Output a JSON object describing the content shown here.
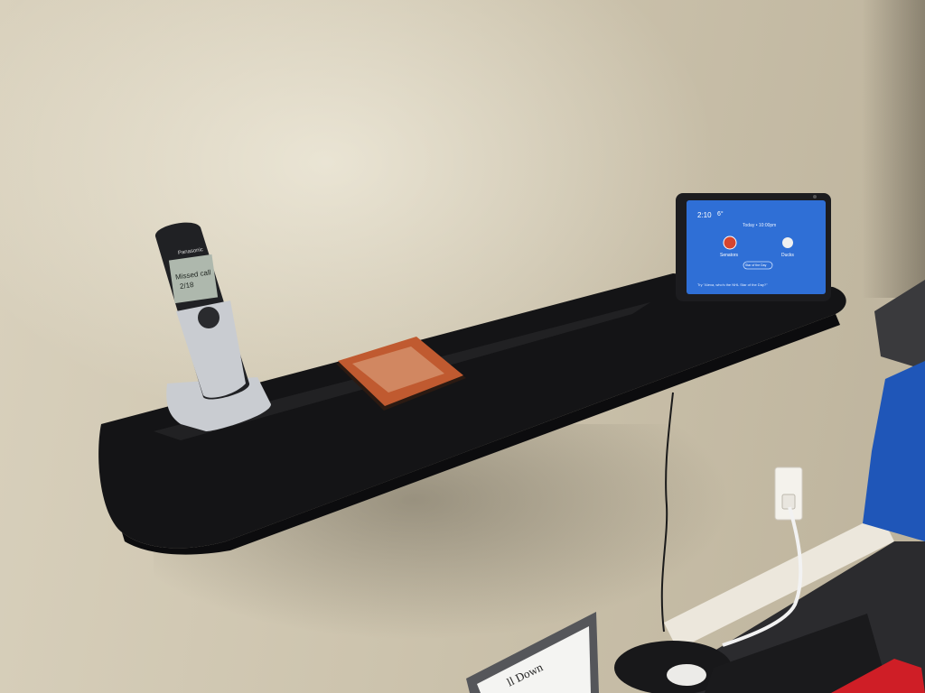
{
  "phone": {
    "brand": "Panasonic",
    "display_line1": "Missed call",
    "display_line2": "2/18"
  },
  "smart_display": {
    "time": "2:10",
    "weather": "6°",
    "headline": "Today • 10:00pm",
    "team_left": "Senators",
    "team_right": "Ducks",
    "pill": "Star of the Day",
    "prompt": "Try \"Alexa, who's the NHL Star of the Day?\""
  },
  "poster": {
    "text": "ll Down"
  },
  "colors": {
    "wall": "#d3cab5",
    "shelf": "#141416",
    "screen": "#2f6fd6",
    "phone_silver": "#c9ccd1",
    "shirt": "#1f56b8",
    "pillow": "#cf1e26"
  }
}
